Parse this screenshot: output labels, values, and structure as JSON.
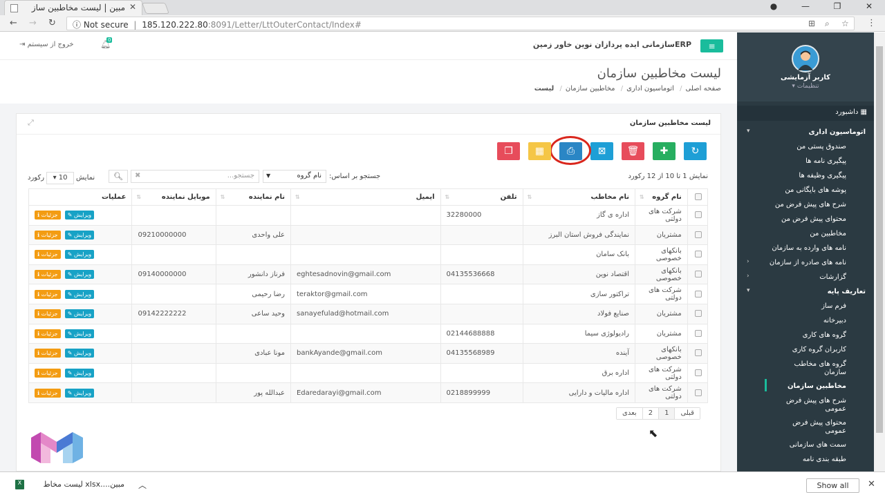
{
  "browser": {
    "tab_title": "مبین | لیست مخاطبین ساز",
    "not_secure": "Not secure",
    "url_host": "185.120.222.80",
    "url_rest": ":8091/Letter/LttOuterContact/Index#"
  },
  "header": {
    "org_title": "ERPسازمانی ایده پردازان نوین خاور زمین",
    "logout": "خروج از سیستم",
    "notif_count": "0"
  },
  "sidebar": {
    "user_name": "کاربر آزمایشی",
    "settings": "تنظیمات",
    "dashboard": "داشبورد",
    "items": [
      {
        "label": "اتوماسیون اداری",
        "type": "h"
      },
      {
        "label": "صندوق پستی من",
        "type": "i"
      },
      {
        "label": "پیگیری نامه ها",
        "type": "i"
      },
      {
        "label": "پیگیری وظیفه ها",
        "type": "i"
      },
      {
        "label": "پوشه های بایگانی من",
        "type": "i"
      },
      {
        "label": "شرح های پیش فرض من",
        "type": "i"
      },
      {
        "label": "محتوای پیش فرض من",
        "type": "i"
      },
      {
        "label": "مخاطبین من",
        "type": "i"
      },
      {
        "label": "نامه های وارده به سازمان",
        "type": "i"
      },
      {
        "label": "نامه های صادره از سازمان",
        "type": "i"
      },
      {
        "label": "گزارشات",
        "type": "i"
      },
      {
        "label": "تعاریف پایه",
        "type": "h"
      },
      {
        "label": "فرم ساز",
        "type": "i"
      },
      {
        "label": "دبیرخانه",
        "type": "i"
      },
      {
        "label": "گروه های کاری",
        "type": "i"
      },
      {
        "label": "کاربران گروه کاری",
        "type": "i"
      },
      {
        "label": "گروه های مخاطب سازمان",
        "type": "t"
      },
      {
        "label": "مخاطبین سازمان",
        "type": "a"
      },
      {
        "label": "شرح های پیش فرض عمومی",
        "type": "t"
      },
      {
        "label": "محتوای پیش فرض عمومی",
        "type": "t"
      },
      {
        "label": "سمت های سازمانی",
        "type": "i"
      },
      {
        "label": "طبقه بندی نامه",
        "type": "i"
      }
    ]
  },
  "page": {
    "title": "لیست مخاطبین سازمان",
    "breadcrumb": [
      "صفحه اصلی",
      "اتوماسیون اداری",
      "مخاطبین سازمان",
      "لیست"
    ],
    "panel_title": "لیست مخاطبین سازمان"
  },
  "toolbar": {
    "colors": {
      "refresh": "#1e9fd6",
      "add": "#27ae60",
      "delete": "#e74c5b",
      "excel": "#1e9fd6",
      "print": "#2a86c5",
      "columns": "#f5c646",
      "copy": "#e74c5b"
    }
  },
  "controls": {
    "info": "نمایش 1 تا 10 از 12 رکورد",
    "search_by": "جستجو بر اساس:",
    "group_option": "نام گروه",
    "search_placeholder": "جستجو...",
    "show_label": "نمایش",
    "page_size": "10",
    "records_label": "رکورد"
  },
  "table": {
    "headers": [
      "نام گروه",
      "نام مخاطب",
      "تلفن",
      "ایمیل",
      "نام نماینده",
      "موبایل نماینده",
      "عملیات"
    ],
    "edit_label": "ویرایش",
    "details_label": "جزئیات",
    "rows": [
      [
        "شرکت های دولتی",
        "اداره ی گاز",
        "32280000",
        "",
        "",
        ""
      ],
      [
        "مشتریان",
        "نمایندگی فروش استان البرز",
        "",
        "",
        "علی واحدی",
        "09210000000"
      ],
      [
        "بانکهای خصوصی",
        "بانک سامان",
        "",
        "",
        "",
        ""
      ],
      [
        "بانکهای خصوصی",
        "اقتصاد نوین",
        "04135536668",
        "eghtesadnovin@gmail.com",
        "فرناز دانشور",
        "09140000000"
      ],
      [
        "شرکت های دولتی",
        "تراکتور سازی",
        "",
        "teraktor@gmail.com",
        "رضا رحیمی",
        ""
      ],
      [
        "مشتریان",
        "صنایع فولاد",
        "",
        "sanayefulad@hotmail.com",
        "وحید ساعی",
        "09142222222"
      ],
      [
        "مشتریان",
        "رادیولوژی سیما",
        "02144688888",
        "",
        "",
        ""
      ],
      [
        "بانکهای خصوصی",
        "آینده",
        "04135568989",
        "bankAyande@gmail.com",
        "مونا عبادی",
        ""
      ],
      [
        "شرکت های دولتی",
        "اداره برق",
        "",
        "",
        "",
        ""
      ],
      [
        "شرکت های دولتی",
        "اداره مالیات و دارایی",
        "0218899999",
        "Edaredarayi@gmail.com",
        "عبدالله پور",
        ""
      ]
    ]
  },
  "pagination": {
    "prev": "قبلی",
    "pages": [
      "1",
      "2"
    ],
    "next": "بعدی"
  },
  "download": {
    "file": "مبین....xlsx  لیست مخاط",
    "show_all": "Show all"
  }
}
